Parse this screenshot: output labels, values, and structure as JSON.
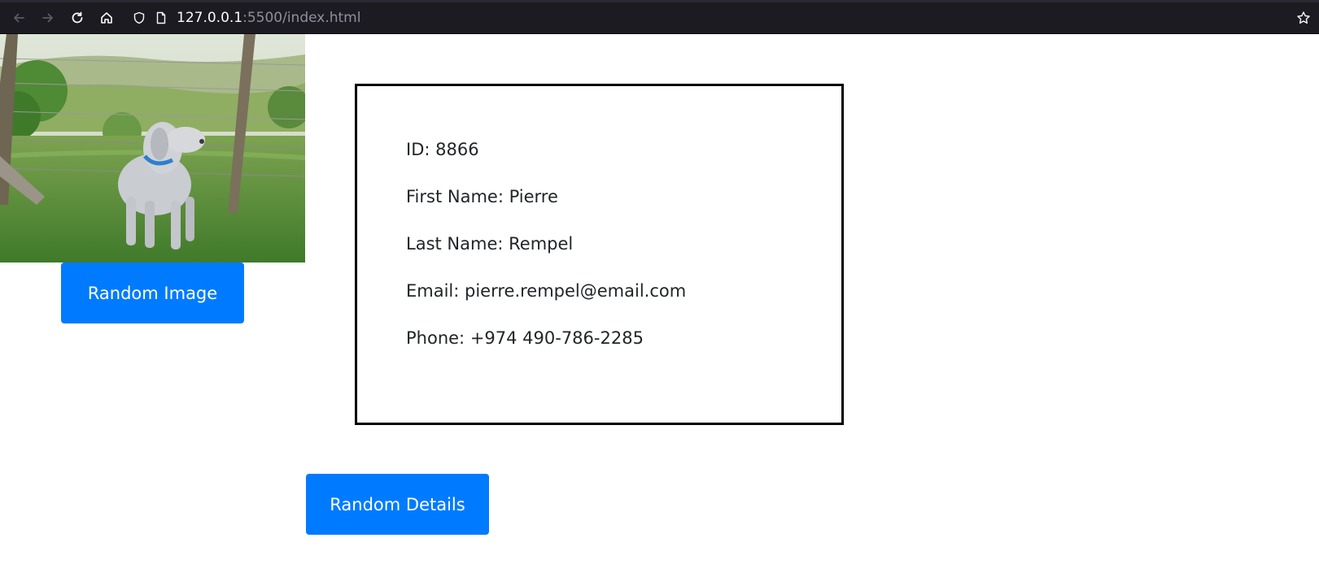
{
  "browser": {
    "url_host": "127.0.0.1",
    "url_rest": ":5500/index.html",
    "icons": [
      "back-icon",
      "forward-icon",
      "reload-icon",
      "home-icon",
      "shield-icon",
      "page-icon",
      "bookmark-star-icon"
    ]
  },
  "image_panel": {
    "image_alt": "dog",
    "button_label": "Random Image"
  },
  "details": {
    "id_label": "ID: ",
    "id_value": "8866",
    "first_name_label": "First Name: ",
    "first_name_value": "Pierre",
    "last_name_label": "Last Name: ",
    "last_name_value": "Rempel",
    "email_label": "Email: ",
    "email_value": "pierre.rempel@email.com",
    "phone_label": "Phone: ",
    "phone_value": "+974 490-786-2285"
  },
  "details_button": {
    "label": "Random Details"
  },
  "colors": {
    "button_bg": "#007bff",
    "button_text": "#ffffff",
    "toolbar_bg": "#1c1b22",
    "box_border": "#000000"
  }
}
